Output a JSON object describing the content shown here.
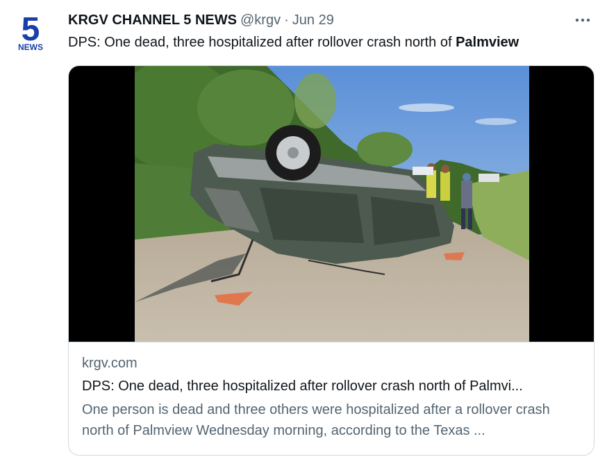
{
  "account": {
    "display_name": "KRGV CHANNEL 5 NEWS",
    "handle": "@krgv",
    "separator": "·",
    "date": "Jun 29",
    "avatar_number": "5",
    "avatar_label": "NEWS",
    "avatar_color": "#1a3fa8",
    "more_icon": "ellipsis-icon"
  },
  "tweet": {
    "text_plain": "DPS: One dead, three hospitalized after rollover crash north of ",
    "text_bold": "Palmview"
  },
  "card": {
    "domain": "krgv.com",
    "title": "DPS: One dead, three hospitalized after rollover crash north of Palmvi...",
    "description": "One person is dead and three others were hospitalized after a rollover crash north of Palmview Wednesday morning, according to the Texas ..."
  },
  "colors": {
    "text_primary": "#0f1419",
    "text_secondary": "#536471",
    "border": "#cfd9de"
  }
}
